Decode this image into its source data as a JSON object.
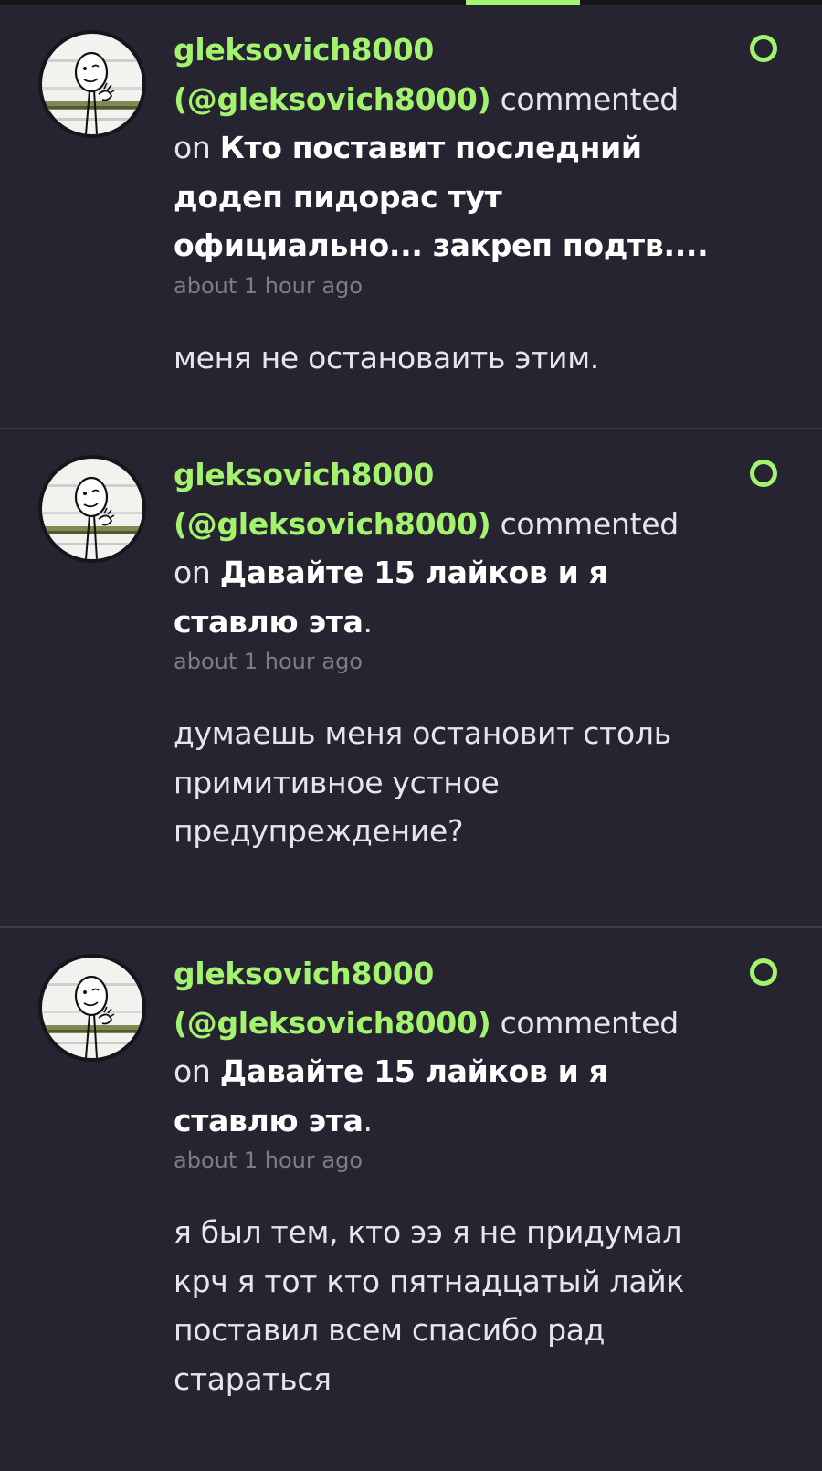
{
  "colors": {
    "background": "#252430",
    "accent": "#a4f36e",
    "divider": "#3d3c48",
    "muted": "#7d7c88"
  },
  "notifications": [
    {
      "display_name": "gleksovich8000",
      "handle": "(@gleksovich8000)",
      "action": "commented",
      "on": "on",
      "post_title": "Кто поставит последний додеп пидорас тут официально... закреп подтв....",
      "trailing": "",
      "time": "about 1 hour ago",
      "body": "меня не остановаить этим.",
      "avatar_icon": "stickman-avatar-icon",
      "unread_icon": "unread-dot-icon"
    },
    {
      "display_name": "gleksovich8000",
      "handle": "(@gleksovich8000)",
      "action": "commented",
      "on": "on",
      "post_title": "Давайте 15 лайков и я ставлю эта",
      "trailing": ".",
      "time": "about 1 hour ago",
      "body": "думаешь меня остановит столь примитивное устное предупреждение?",
      "avatar_icon": "stickman-avatar-icon",
      "unread_icon": "unread-dot-icon"
    },
    {
      "display_name": "gleksovich8000",
      "handle": "(@gleksovich8000)",
      "action": "commented",
      "on": "on",
      "post_title": "Давайте 15 лайков и я ставлю эта",
      "trailing": ".",
      "time": "about 1 hour ago",
      "body": "я был тем, кто ээ я не придумал крч я тот кто пятнадцатый лайк поставил всем спасибо рад стараться",
      "avatar_icon": "stickman-avatar-icon",
      "unread_icon": "unread-dot-icon"
    }
  ]
}
